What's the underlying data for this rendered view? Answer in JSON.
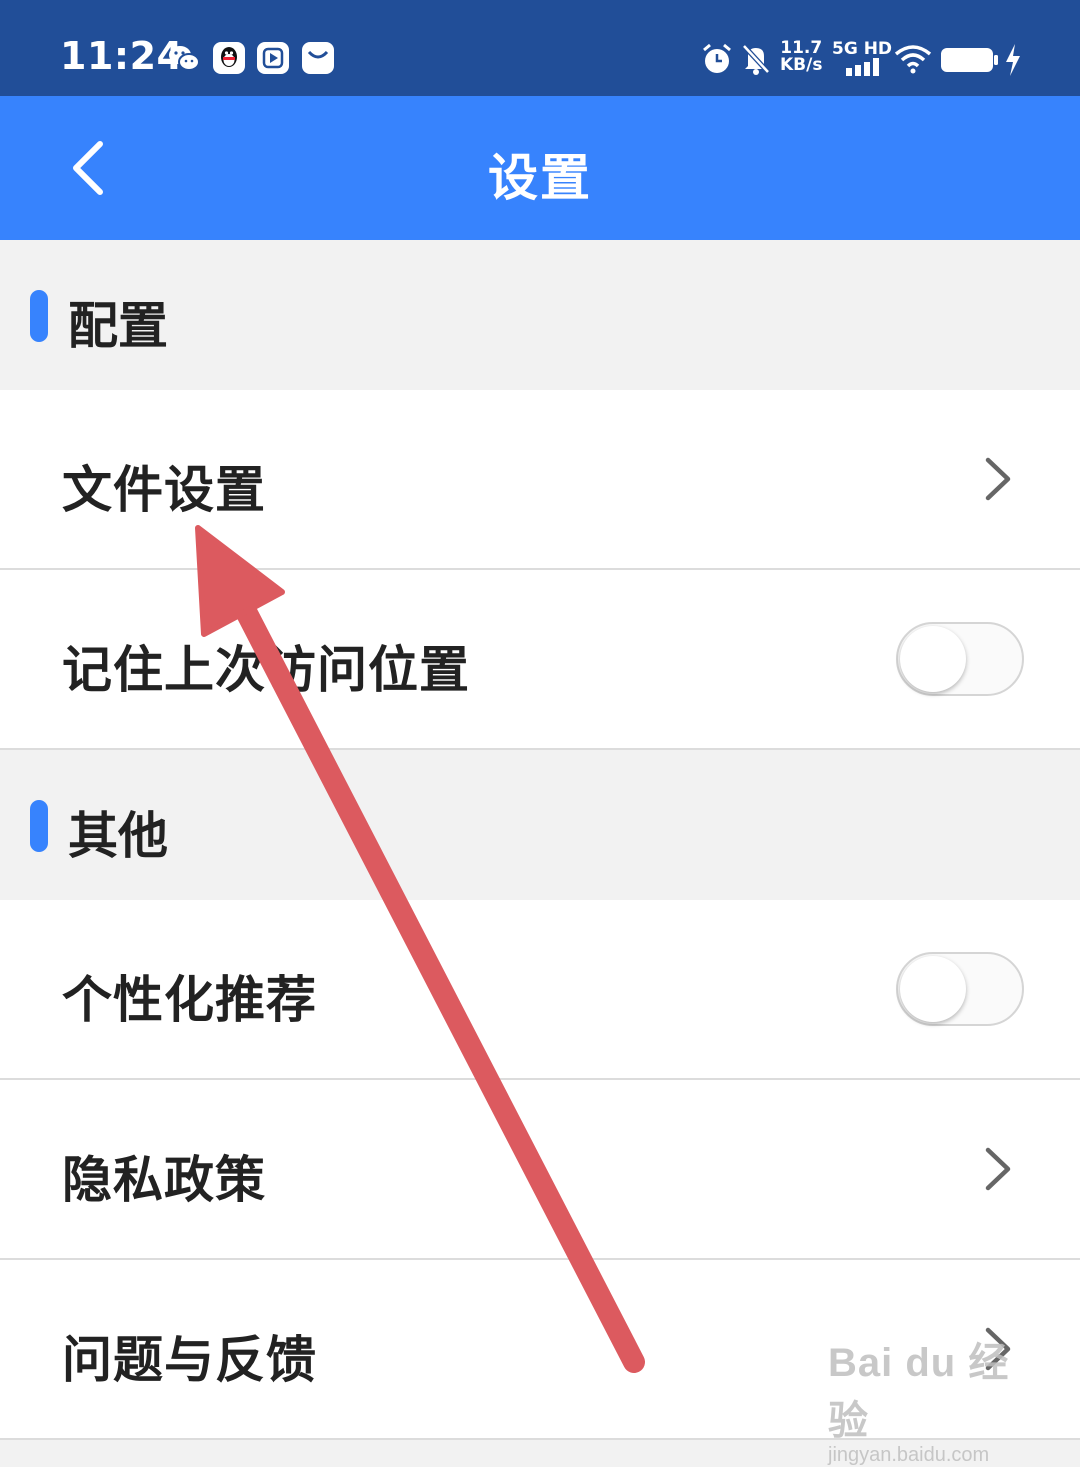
{
  "status_bar": {
    "time": "11:24",
    "speed_value": "11.7",
    "speed_unit": "KB/s",
    "network": "5G HD",
    "icons": [
      "wechat-icon",
      "qq-icon",
      "video-app-icon",
      "mail-app-icon",
      "alarm-icon",
      "mute-icon",
      "signal-icon",
      "wifi-icon",
      "battery-icon",
      "charging-icon"
    ]
  },
  "header": {
    "title": "设置",
    "back_icon": "chevron-left-icon"
  },
  "sections": [
    {
      "title": "配置",
      "items": [
        {
          "label": "文件设置",
          "control": "chevron"
        },
        {
          "label": "记住上次访问位置",
          "control": "toggle",
          "on": false
        }
      ]
    },
    {
      "title": "其他",
      "items": [
        {
          "label": "个性化推荐",
          "control": "toggle",
          "on": false
        },
        {
          "label": "隐私政策",
          "control": "chevron"
        },
        {
          "label": "问题与反馈",
          "control": "chevron"
        }
      ]
    }
  ],
  "watermark": {
    "main": "Bai du 经验",
    "sub": "jingyan.baidu.com"
  },
  "colors": {
    "status_bar": "#214e98",
    "header": "#3783fd",
    "accent": "#3783fd",
    "arrow": "#dc5a5f"
  }
}
